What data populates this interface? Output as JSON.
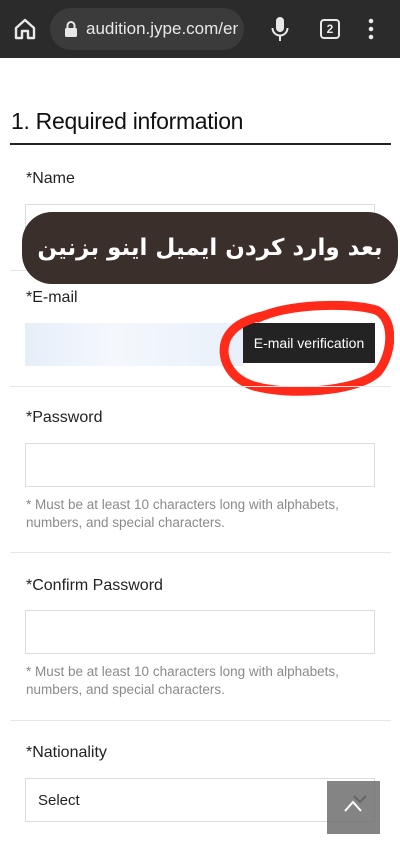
{
  "browser": {
    "url": "audition.jype.com/en",
    "tab_count": "2"
  },
  "form": {
    "section_title": "1. Required information",
    "name_label": "*Name",
    "email_label": "*E-mail",
    "email_verify_button": "E-mail verification",
    "password_label": "*Password",
    "password_hint": "* Must be at least 10 characters long with alphabets, numbers, and special characters.",
    "confirm_password_label": "*Confirm Password",
    "confirm_password_hint": "* Must be at least 10 characters long with alphabets, numbers, and special characters.",
    "nationality_label": "*Nationality",
    "nationality_value": "Select"
  },
  "overlay": {
    "banner_text": "بعد وارد کردن ایمیل اینو بزنین",
    "highlight_color": "#ff2a1a",
    "banner_color": "#3a2f2a"
  },
  "icons": {
    "home": "home-icon",
    "lock": "lock-icon",
    "mic": "mic-icon",
    "menu": "kebab-menu-icon",
    "scroll_top": "chevron-up-icon",
    "select": "chevron-down-icon"
  }
}
